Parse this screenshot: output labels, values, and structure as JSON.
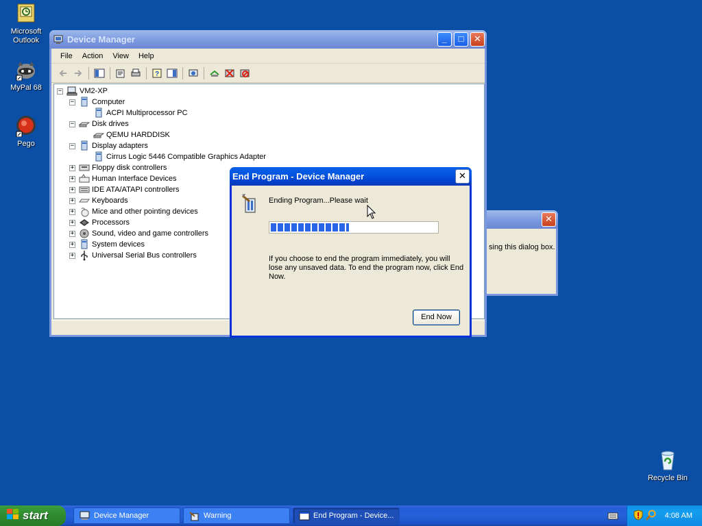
{
  "desktop": {
    "icons": [
      {
        "label1": "Microsoft",
        "label2": "Outlook"
      },
      {
        "label1": "MyPal 68"
      },
      {
        "label1": "Pego"
      },
      {
        "label1": "Recycle Bin"
      }
    ]
  },
  "device_manager": {
    "title": "Device Manager",
    "menu": [
      "File",
      "Action",
      "View",
      "Help"
    ],
    "tree": {
      "root": "VM2-XP",
      "computer": "Computer",
      "computer_child": "ACPI Multiprocessor PC",
      "disk_drives": "Disk drives",
      "disk_child": "QEMU HARDDISK",
      "display_adapters": "Display adapters",
      "display_child": "Cirrus Logic 5446 Compatible Graphics Adapter",
      "floppy": "Floppy disk controllers",
      "hid": "Human Interface Devices",
      "ide": "IDE ATA/ATAPI controllers",
      "keyboards": "Keyboards",
      "mice": "Mice and other pointing devices",
      "processors": "Processors",
      "sound": "Sound, video and game controllers",
      "system": "System devices",
      "usb": "Universal Serial Bus controllers"
    }
  },
  "warning_window": {
    "text": "sing this dialog box."
  },
  "end_program": {
    "title": "End Program - Device Manager",
    "message": "Ending Program...Please wait",
    "progress": 0.47,
    "info": "If you choose to end the program immediately, you will lose any unsaved data. To end the program now, click End Now.",
    "button": "End Now"
  },
  "taskbar": {
    "start": "start",
    "tasks": [
      "Device Manager",
      "Warning",
      "End Program - Device..."
    ],
    "clock": "4:08 AM"
  },
  "colors": {
    "desktop": "#0a4ea5",
    "titlebar_active": "#0256e0",
    "progress": "#2a65e6"
  }
}
